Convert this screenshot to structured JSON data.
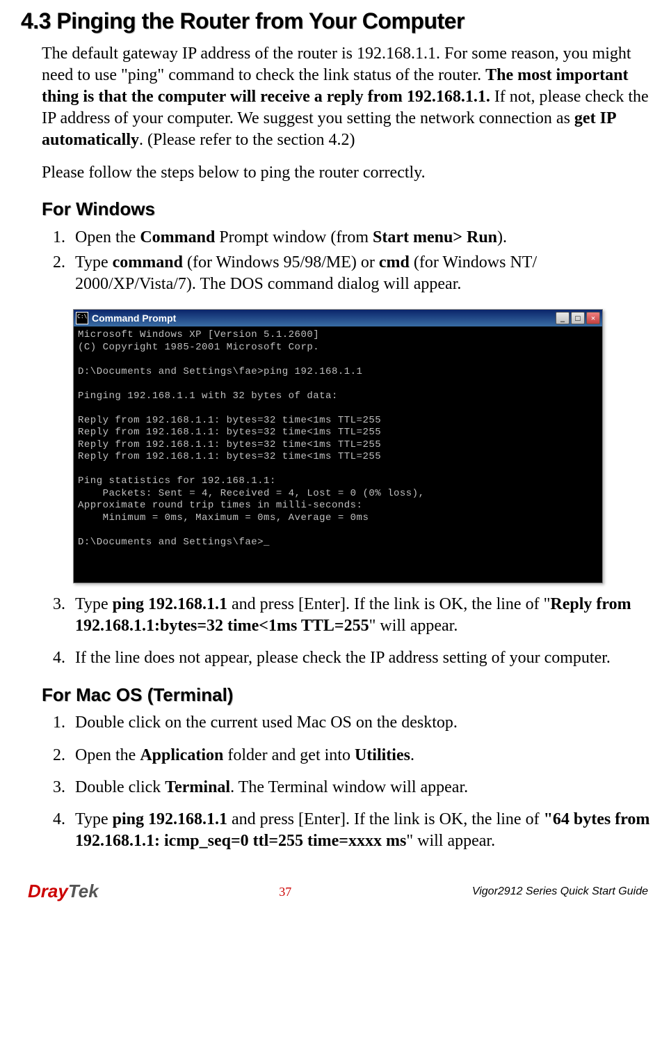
{
  "section_title": "4.3 Pinging the Router from Your Computer",
  "intro": {
    "text1": "The default gateway IP address of the router is 192.168.1.1. For some reason, you might need to use \"ping\" command to check the link status of the router. ",
    "bold1": "The most important thing is that the computer will receive a reply from 192.168.1.1.",
    "text2": " If not, please check the IP address of your computer. We suggest you setting the network connection as ",
    "bold2": "get IP automatically",
    "text3": ". (Please refer to the section 4.2)"
  },
  "intro2": "Please follow the steps below to ping the router correctly.",
  "windows_title": "For Windows",
  "windows_steps": {
    "s1_a": "Open the ",
    "s1_b": "Command",
    "s1_c": " Prompt window (from ",
    "s1_d": "Start menu> Run",
    "s1_e": ").",
    "s2_a": "Type ",
    "s2_b": "command",
    "s2_c": " (for Windows 95/98/ME) or ",
    "s2_d": "cmd",
    "s2_e": " (for Windows NT/ 2000/XP/Vista/7). The DOS command dialog will appear.",
    "s3_a": "Type ",
    "s3_b": "ping 192.168.1.1",
    "s3_c": " and press [Enter]. If the link is OK, the line of \"",
    "s3_d": "Reply from 192.168.1.1:bytes=32 time<1ms TTL=255",
    "s3_e": "\" will appear.",
    "s4": "If the line does not appear, please check the IP address setting of your computer."
  },
  "terminal": {
    "title": "Command Prompt",
    "content": "Microsoft Windows XP [Version 5.1.2600]\n(C) Copyright 1985-2001 Microsoft Corp.\n\nD:\\Documents and Settings\\fae>ping 192.168.1.1\n\nPinging 192.168.1.1 with 32 bytes of data:\n\nReply from 192.168.1.1: bytes=32 time<1ms TTL=255\nReply from 192.168.1.1: bytes=32 time<1ms TTL=255\nReply from 192.168.1.1: bytes=32 time<1ms TTL=255\nReply from 192.168.1.1: bytes=32 time<1ms TTL=255\n\nPing statistics for 192.168.1.1:\n    Packets: Sent = 4, Received = 4, Lost = 0 (0% loss),\nApproximate round trip times in milli-seconds:\n    Minimum = 0ms, Maximum = 0ms, Average = 0ms\n\nD:\\Documents and Settings\\fae>_"
  },
  "mac_title": "For Mac OS (Terminal)",
  "mac_steps": {
    "s1": "Double click on the current used Mac OS on the desktop.",
    "s2_a": "Open the ",
    "s2_b": "Application",
    "s2_c": " folder and get into ",
    "s2_d": "Utilities",
    "s2_e": ".",
    "s3_a": "Double click ",
    "s3_b": "Terminal",
    "s3_c": ". The Terminal window will appear.",
    "s4_a": "Type ",
    "s4_b": "ping 192.168.1.1",
    "s4_c": " and press [Enter]. If the link is OK, the line of ",
    "s4_d": "\"64 bytes from 192.168.1.1: icmp_seq=0 ttl=255 time=xxxx ms",
    "s4_e": "\" will appear."
  },
  "footer": {
    "logo_dray": "Dray",
    "logo_tek": "Tek",
    "page": "37",
    "guide": "Vigor2912 Series Quick Start Guide"
  }
}
